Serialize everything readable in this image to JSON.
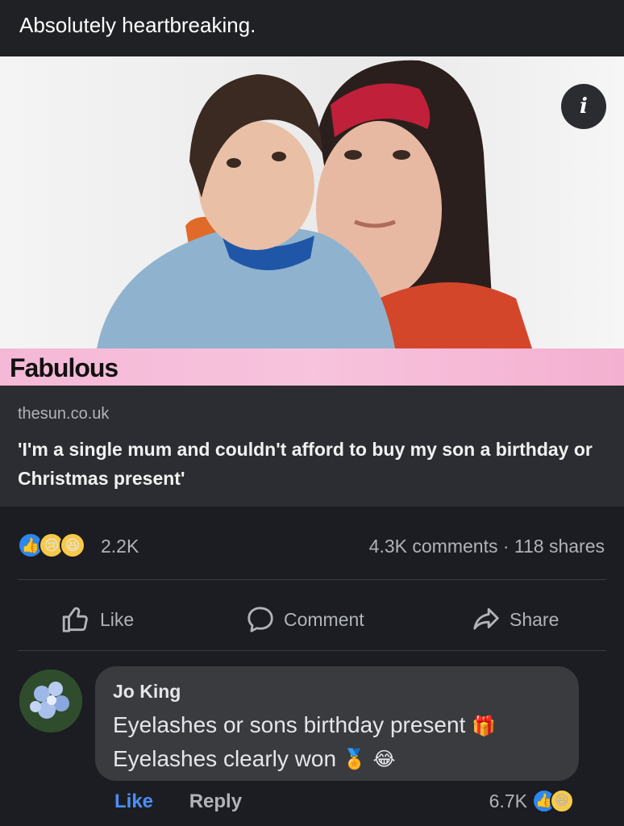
{
  "post": {
    "text": "Absolutely heartbreaking."
  },
  "media": {
    "brand": "Fabulous",
    "info_icon": "i"
  },
  "link": {
    "domain": "thesun.co.uk",
    "headline": "'I'm a single mum and couldn't afford to buy my son a birthday or Christmas present'"
  },
  "reactions": {
    "icons": [
      "like-icon",
      "sad-icon",
      "haha-icon"
    ],
    "count": "2.2K",
    "stats": "4.3K comments · 118 shares"
  },
  "actions": {
    "like": "Like",
    "comment": "Comment",
    "share": "Share"
  },
  "comment": {
    "author": "Jo King",
    "line1": "Eyelashes or sons birthday present",
    "line2": "Eyelashes clearly won",
    "like": "Like",
    "reply": "Reply",
    "reaction_count": "6.7K"
  },
  "colors": {
    "background": "#1b1d22",
    "link_blue": "#4a8ff7",
    "brand_strip": "#f5b8d6"
  }
}
